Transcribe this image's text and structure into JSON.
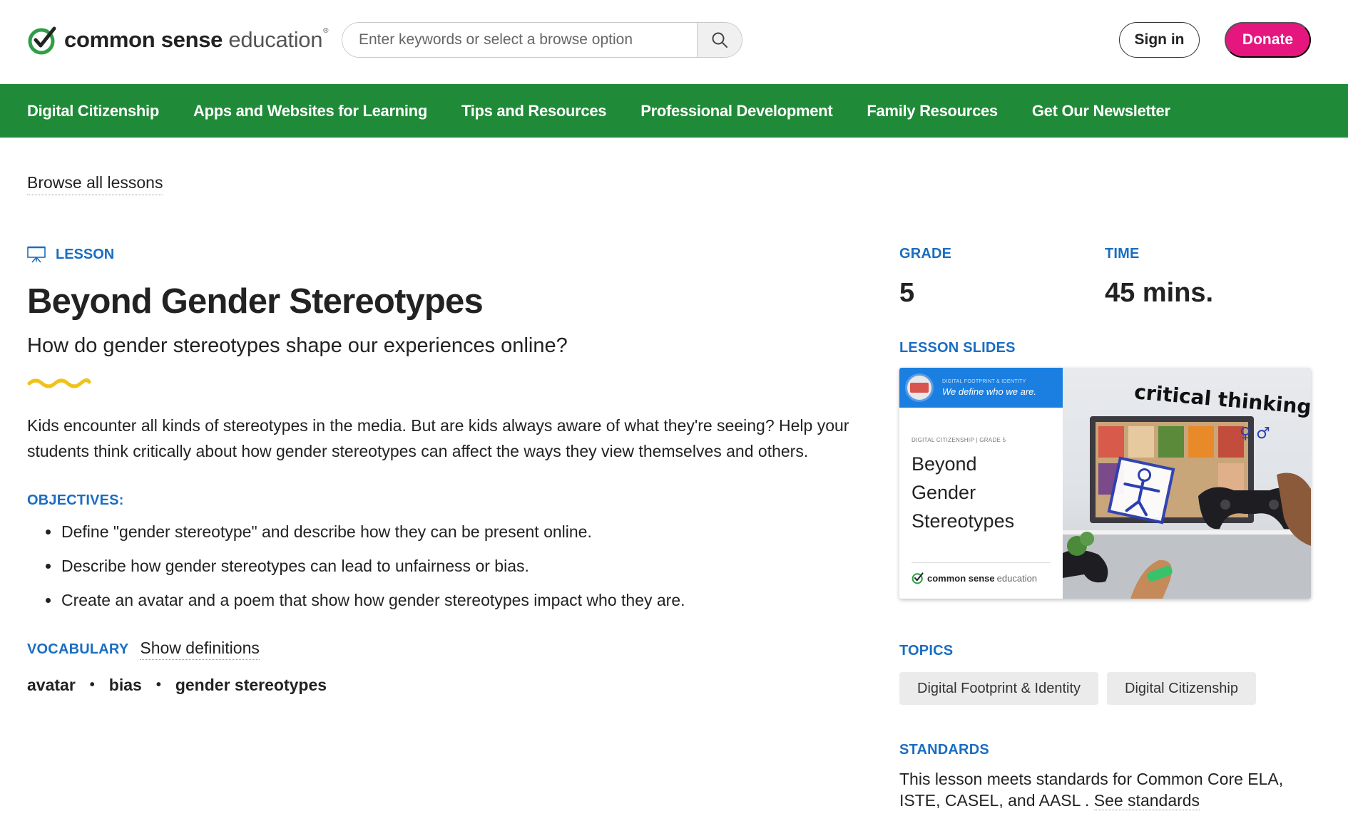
{
  "header": {
    "logo_bold": "common sense",
    "logo_light": "education",
    "logo_mark": "®",
    "search_placeholder": "Enter keywords or select a browse option",
    "signin_label": "Sign in",
    "donate_label": "Donate"
  },
  "nav": {
    "items": [
      "Digital Citizenship",
      "Apps and Websites for Learning",
      "Tips and Resources",
      "Professional Development",
      "Family Resources",
      "Get Our Newsletter"
    ]
  },
  "breadcrumb": {
    "label": "Browse all lessons"
  },
  "lesson": {
    "type_label": "LESSON",
    "title": "Beyond Gender Stereotypes",
    "subtitle": "How do gender stereotypes shape our experiences online?",
    "description": "Kids encounter all kinds of stereotypes in the media. But are kids always aware of what they're seeing? Help your students think critically about how gender stereotypes can affect the ways they view themselves and others.",
    "objectives_label": "OBJECTIVES:",
    "objectives": [
      "Define \"gender stereotype\" and describe how they can be present online.",
      "Describe how gender stereotypes can lead to unfairness or bias.",
      "Create an avatar and a poem that show how gender stereotypes impact who they are."
    ],
    "vocabulary_label": "VOCABULARY",
    "show_definitions_label": "Show definitions",
    "vocabulary": [
      "avatar",
      "bias",
      "gender stereotypes"
    ],
    "vocab_separator": "•"
  },
  "sidebar": {
    "grade_label": "GRADE",
    "grade_value": "5",
    "time_label": "TIME",
    "time_value": "45 mins.",
    "slides_label": "LESSON SLIDES",
    "slide": {
      "banner_small": "DIGITAL FOOTPRINT & IDENTITY",
      "banner_main": "We define who we are.",
      "kicker": "DIGITAL CITIZENSHIP | GRADE 5",
      "title_lines": [
        "Beyond",
        "Gender",
        "Stereotypes"
      ],
      "logo_bold": "common sense",
      "logo_light": "education",
      "photo_caption": "critical thinking",
      "photo_symbols": "♀ ♂"
    },
    "topics_label": "TOPICS",
    "topics": [
      "Digital Footprint & Identity",
      "Digital Citizenship"
    ],
    "standards_label": "STANDARDS",
    "standards_prefix": "This lesson meets standards for  Common Core ELA, ISTE,  CASEL, and  AASL . ",
    "see_standards_label": "See standards"
  },
  "colors": {
    "brand_green": "#1f8a37",
    "accent_blue": "#1a6dc2",
    "donate_pink": "#e6167f",
    "squiggle_yellow": "#f2c21b"
  }
}
